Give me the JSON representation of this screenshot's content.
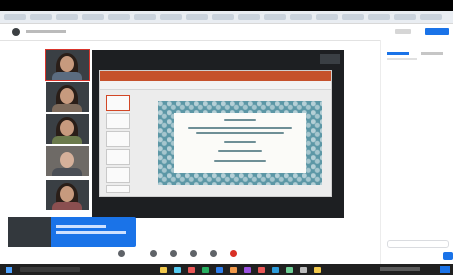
{
  "browser": {
    "tab_count_visible": 24,
    "address_text": ""
  },
  "meeting": {
    "participants": [
      "participant-1",
      "participant-2",
      "participant-3",
      "participant-4",
      "participant-5"
    ],
    "presentation": {
      "app": "PowerPoint",
      "slide_count_visible": 6,
      "selected_slide": 1
    },
    "side_panel": {
      "primary_button_label": ""
    }
  },
  "toolbar_icons": [
    "camera-icon",
    "mic-icon",
    "share-icon",
    "react-icon",
    "more-icon",
    "end-call-icon"
  ],
  "taskbar": {
    "icon_colors": [
      "#f2c94c",
      "#56ccf2",
      "#eb5757",
      "#27ae60",
      "#2f80ed",
      "#f2994a",
      "#9b51e0",
      "#eb5757",
      "#2d9cdb",
      "#6fcf97",
      "#bdbdbd",
      "#f2c94c"
    ]
  },
  "colors": {
    "accent": "#1a73e8",
    "stage_bg": "#1d1f22",
    "ppt_ribbon": "#c5512b",
    "slide_border": "#5c97a6"
  }
}
